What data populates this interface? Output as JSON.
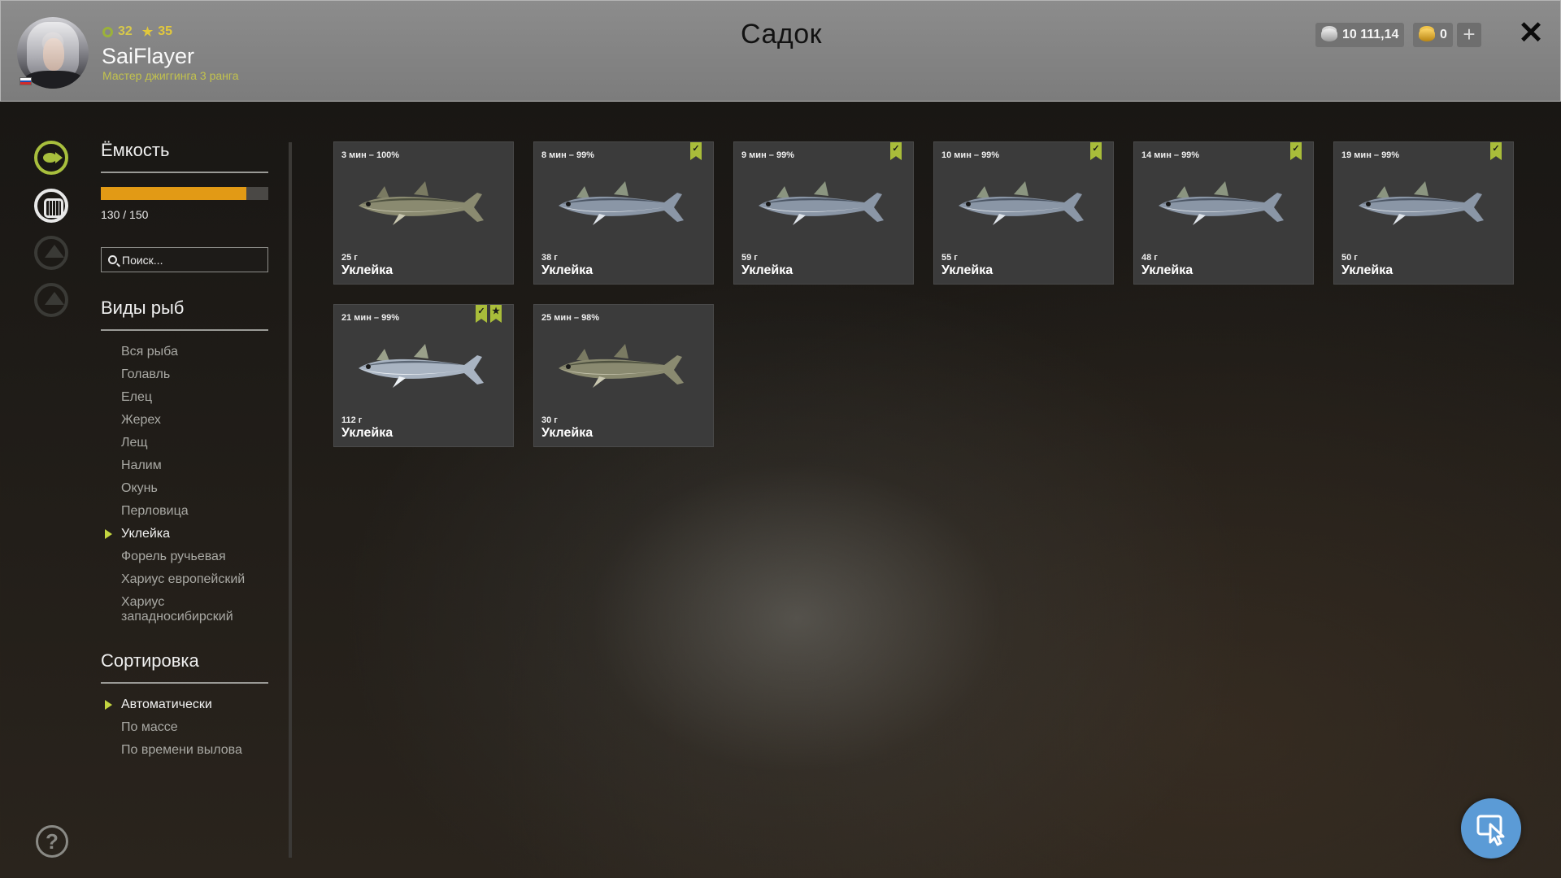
{
  "header": {
    "title": "Садок",
    "player": {
      "level": "32",
      "rank_level": "35",
      "name": "SaiFlayer",
      "rank_title": "Мастер джиггинга 3 ранга"
    },
    "currency": {
      "silver": "10 111,14",
      "gold": "0",
      "add_label": "+"
    },
    "close_label": "✕"
  },
  "capacity": {
    "title": "Ёмкость",
    "text": "130 / 150",
    "fraction": 0.8667
  },
  "search": {
    "placeholder": "Поиск..."
  },
  "species": {
    "title": "Виды рыб",
    "items": [
      "Вся рыба",
      "Голавль",
      "Елец",
      "Жерех",
      "Лещ",
      "Налим",
      "Окунь",
      "Перловица",
      "Уклейка",
      "Форель ручьевая",
      "Хариус европейский",
      "Хариус западносибирский"
    ],
    "active_index": 8
  },
  "sorting": {
    "title": "Сортировка",
    "items": [
      "Автоматически",
      "По массе",
      "По времени вылова"
    ],
    "active_index": 0
  },
  "help_label": "?",
  "colors": {
    "accent_green": "#a9bd3a",
    "capacity_orange": "#e29a15",
    "cursor_button": "#5b9bd6"
  },
  "fish_cards": [
    {
      "time": "3 мин – 100%",
      "weight": "25 г",
      "name": "Уклейка",
      "badges": [],
      "tone": "olive"
    },
    {
      "time": "8 мин – 99%",
      "weight": "38 г",
      "name": "Уклейка",
      "badges": [
        "bookmark"
      ],
      "tone": "blue"
    },
    {
      "time": "9 мин – 99%",
      "weight": "59 г",
      "name": "Уклейка",
      "badges": [
        "bookmark"
      ],
      "tone": "blue"
    },
    {
      "time": "10 мин – 99%",
      "weight": "55 г",
      "name": "Уклейка",
      "badges": [
        "bookmark"
      ],
      "tone": "blue"
    },
    {
      "time": "14 мин – 99%",
      "weight": "48 г",
      "name": "Уклейка",
      "badges": [
        "bookmark"
      ],
      "tone": "blue"
    },
    {
      "time": "19 мин – 99%",
      "weight": "50 г",
      "name": "Уклейка",
      "badges": [
        "bookmark"
      ],
      "tone": "blue"
    },
    {
      "time": "21 мин – 99%",
      "weight": "112 г",
      "name": "Уклейка",
      "badges": [
        "bookmark",
        "star"
      ],
      "tone": "silver"
    },
    {
      "time": "25 мин – 98%",
      "weight": "30 г",
      "name": "Уклейка",
      "badges": [],
      "tone": "olive"
    }
  ]
}
